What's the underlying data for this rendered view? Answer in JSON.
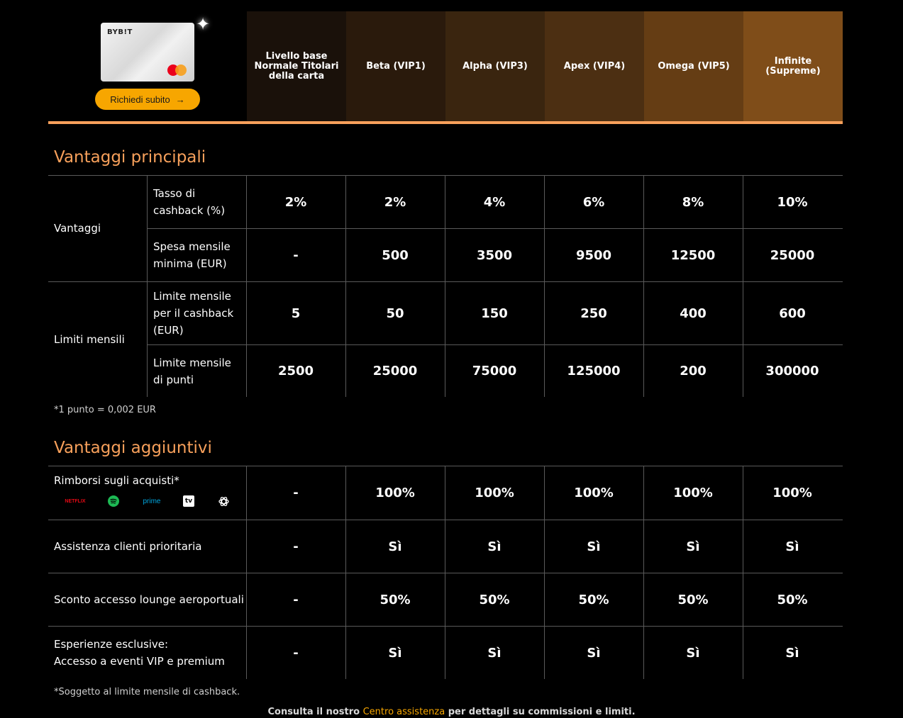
{
  "header": {
    "card_brand": "BYB!T",
    "cta_label": "Richiedi subito",
    "cta_arrow": "→",
    "sparkle": "✦",
    "tiers": [
      {
        "label": "Livello base Normale Titolari della carta",
        "color": "#1a110a"
      },
      {
        "label": "Beta (VIP1)",
        "color": "#2a1a0c"
      },
      {
        "label": "Alpha (VIP3)",
        "color": "#3a250f"
      },
      {
        "label": "Apex (VIP4)",
        "color": "#4c2f12"
      },
      {
        "label": "Omega (VIP5)",
        "color": "#653d14"
      },
      {
        "label": "Infinite (Supreme)",
        "color": "#7f4d19"
      }
    ]
  },
  "main": {
    "title": "Vantaggi principali",
    "groups": [
      "Vantaggi",
      "Limiti mensili"
    ],
    "rows": [
      {
        "label": "Tasso di cashback (%)",
        "values": [
          "2%",
          "2%",
          "4%",
          "6%",
          "8%",
          "10%"
        ]
      },
      {
        "label": "Spesa mensile minima (EUR)",
        "values": [
          "-",
          "500",
          "3500",
          "9500",
          "12500",
          "25000"
        ]
      },
      {
        "label": "Limite mensile per il cashback (EUR)",
        "values": [
          "5",
          "50",
          "150",
          "250",
          "400",
          "600"
        ]
      },
      {
        "label": "Limite mensile di punti",
        "values": [
          "2500",
          "25000",
          "75000",
          "125000",
          "200",
          "300000"
        ]
      }
    ],
    "note": "*1 punto = 0,002 EUR"
  },
  "additional": {
    "title": "Vantaggi aggiuntivi",
    "brands": {
      "netflix": "NETFLIX",
      "prime": "prime",
      "tv": "tv"
    },
    "rows": [
      {
        "label": "Rimborsi sugli acquisti*",
        "values": [
          "-",
          "100%",
          "100%",
          "100%",
          "100%",
          "100%"
        ]
      },
      {
        "label": "Assistenza clienti prioritaria",
        "values": [
          "-",
          "Sì",
          "Sì",
          "Sì",
          "Sì",
          "Sì"
        ]
      },
      {
        "label": "Sconto accesso lounge aeroportuali",
        "values": [
          "-",
          "50%",
          "50%",
          "50%",
          "50%",
          "50%"
        ]
      },
      {
        "label_line1": "Esperienze esclusive:",
        "label_line2": "Accesso a eventi VIP e premium",
        "values": [
          "-",
          "Sì",
          "Sì",
          "Sì",
          "Sì",
          "Sì"
        ]
      }
    ],
    "note": "*Soggetto al limite mensile di cashback."
  },
  "footer": {
    "before": "Consulta il nostro ",
    "link": "Centro assistenza",
    "after": " per dettagli su commissioni e limiti."
  },
  "colors": {
    "accent": "#f7a600",
    "heading": "#f7a05b"
  }
}
